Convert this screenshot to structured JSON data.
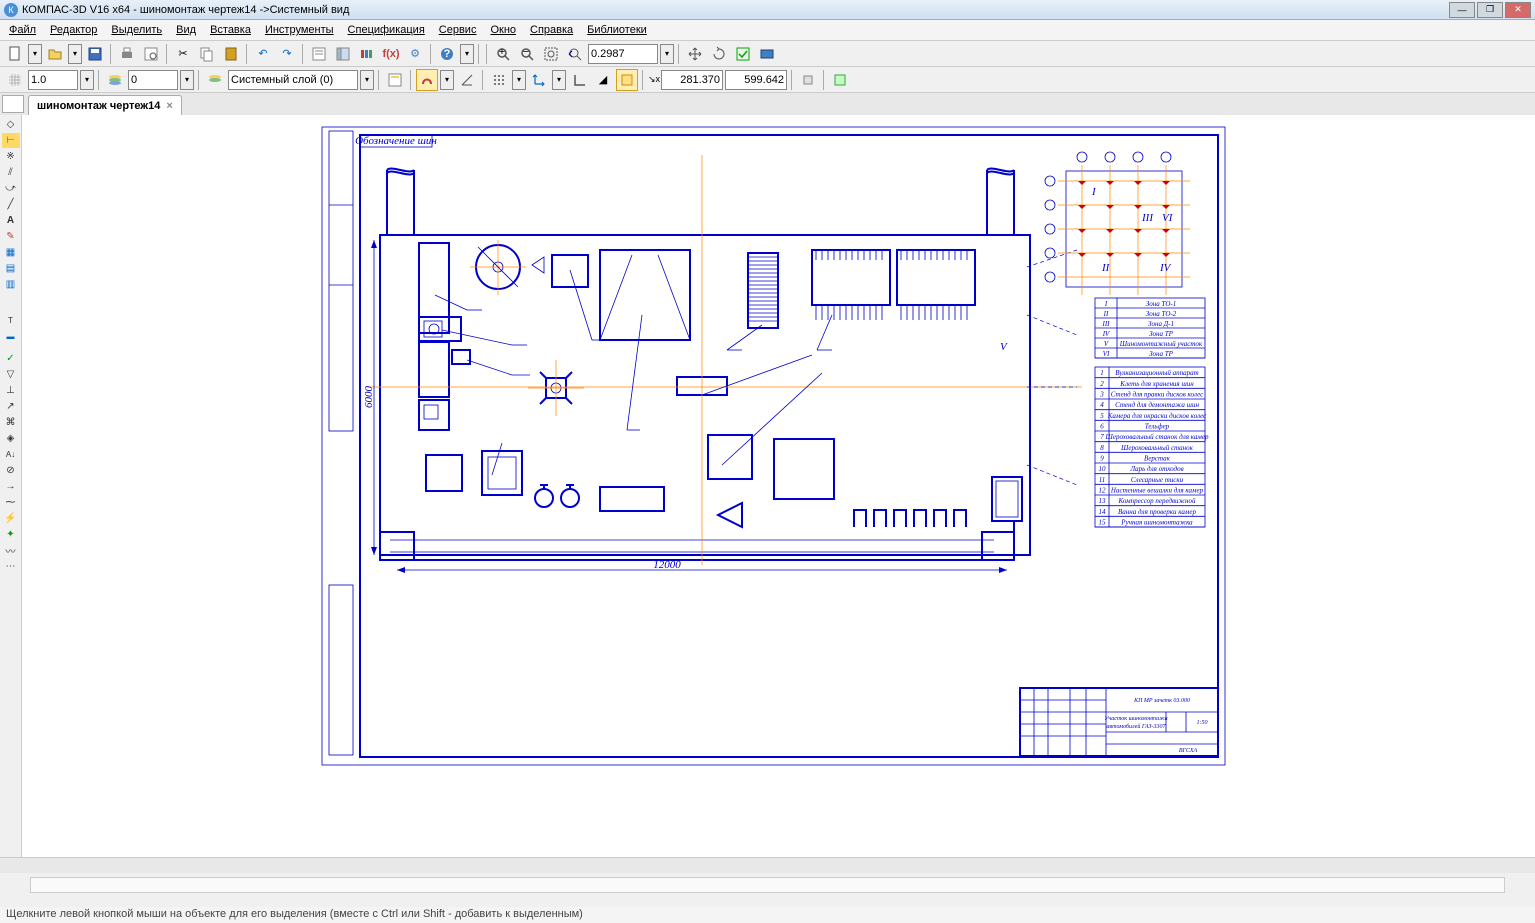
{
  "window": {
    "title": "КОМПАС-3D V16  x64 - шиномонтаж чертеж14 ->Системный вид"
  },
  "menu": {
    "file": "Файл",
    "editor": "Редактор",
    "select": "Выделить",
    "view": "Вид",
    "insert": "Вставка",
    "tools": "Инструменты",
    "spec": "Спецификация",
    "service": "Сервис",
    "window": "Окно",
    "help": "Справка",
    "libraries": "Библиотеки"
  },
  "toolbar2": {
    "width": "1.0",
    "layer_num": "0",
    "layer_name": "Системный слой (0)",
    "zoom": "0.2987",
    "coord_x": "281.370",
    "coord_y": "599.642"
  },
  "document_tab": {
    "name": "шиномонтаж чертеж14"
  },
  "drawing_labels": {
    "frame_label": "Обозначение шин",
    "dimension_h": "12000",
    "dimension_v": "6000",
    "view_letter": "V"
  },
  "zone_table": {
    "rows": [
      {
        "num": "I",
        "label": "Зона ТО-1"
      },
      {
        "num": "II",
        "label": "Зона ТО-2"
      },
      {
        "num": "III",
        "label": "Зона Д-1"
      },
      {
        "num": "IV",
        "label": "Зона ТР"
      },
      {
        "num": "V",
        "label": "Шиномонтажный участок"
      },
      {
        "num": "VI",
        "label": "Зона ТР"
      }
    ]
  },
  "equipment_table": {
    "rows": [
      {
        "num": "1",
        "label": "Вулканизационный аппарат"
      },
      {
        "num": "2",
        "label": "Клеть для хранения шин"
      },
      {
        "num": "3",
        "label": "Стенд для правки дисков колес"
      },
      {
        "num": "4",
        "label": "Стенд для демонтажа шин"
      },
      {
        "num": "5",
        "label": "Камера для окраски дисков колес"
      },
      {
        "num": "6",
        "label": "Тельфер"
      },
      {
        "num": "7",
        "label": "Шероховальный станок для камер"
      },
      {
        "num": "8",
        "label": "Шероховальный станок"
      },
      {
        "num": "9",
        "label": "Верстак"
      },
      {
        "num": "10",
        "label": "Ларь для отходов"
      },
      {
        "num": "11",
        "label": "Слесарные тиски"
      },
      {
        "num": "12",
        "label": "Настенные вешалки для камер"
      },
      {
        "num": "13",
        "label": "Компрессор передвижной"
      },
      {
        "num": "14",
        "label": "Ванна для проверки камер"
      },
      {
        "num": "15",
        "label": "Ручная шиномонтажка"
      }
    ]
  },
  "titleblock": {
    "code": "КП МР зачетк 03.000",
    "name1": "Участок шиномонтажа",
    "name2": "автомобилей ГАЗ-3307",
    "scale": "1:50",
    "org": "ВГСХА"
  },
  "status": {
    "text": "Щелкните левой кнопкой мыши на объекте для его выделения (вместе с Ctrl или Shift - добавить к выделенным)"
  }
}
